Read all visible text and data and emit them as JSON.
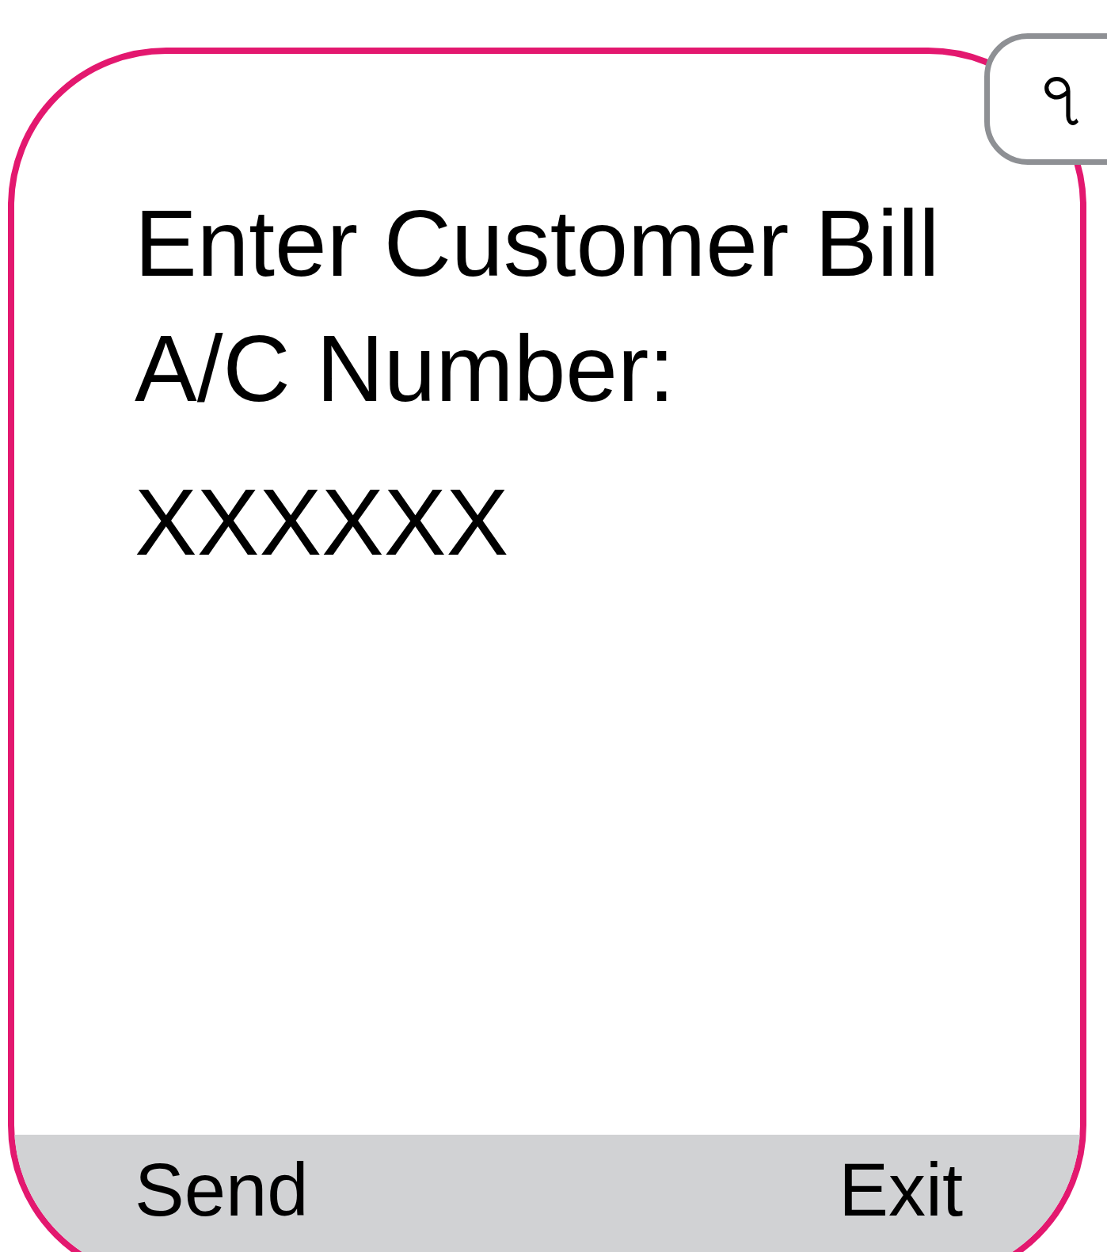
{
  "badge": "৭",
  "prompt": "Enter Customer Bill A/C Number:",
  "input": {
    "value": "XXXXXX"
  },
  "softkeys": [
    {
      "label": "Send"
    },
    {
      "label": "Exit"
    }
  ]
}
